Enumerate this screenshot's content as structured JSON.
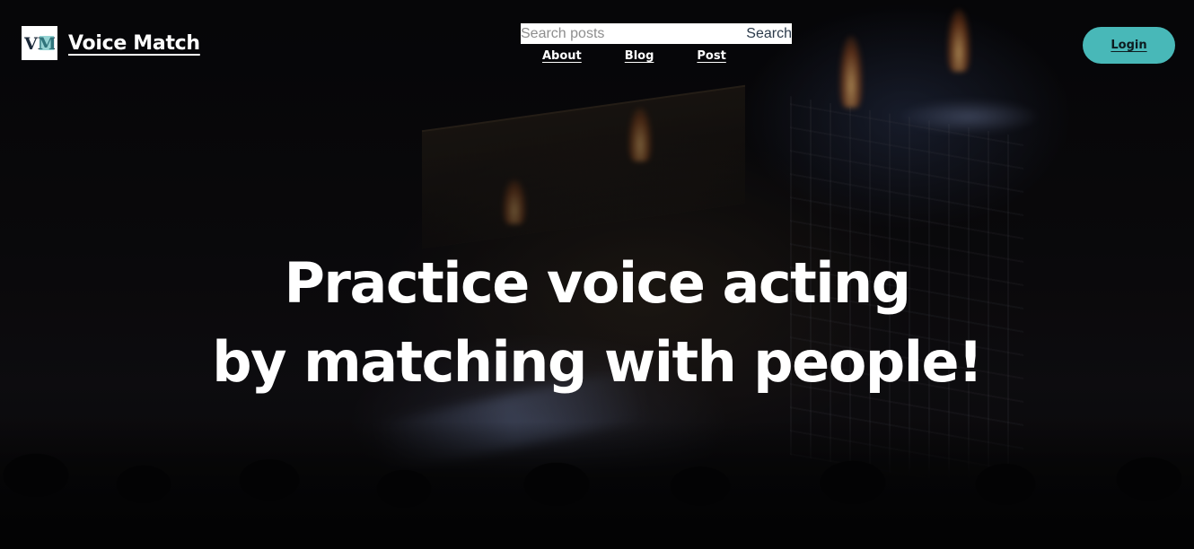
{
  "header": {
    "brand": "Voice Match",
    "logo_text": "VM",
    "search": {
      "placeholder": "Search posts",
      "value": "",
      "button_label": "Search"
    },
    "nav": [
      {
        "label": "About"
      },
      {
        "label": "Blog"
      },
      {
        "label": "Post"
      }
    ],
    "login_label": "Login"
  },
  "hero": {
    "line1": "Practice voice acting",
    "line2": "by matching with people!"
  },
  "colors": {
    "accent": "#48b8b8",
    "logo_dark": "#1c2a3a",
    "logo_teal": "#3fb1b1",
    "text": "#ffffff"
  },
  "icons": {
    "logo": "vm-logo-icon"
  }
}
